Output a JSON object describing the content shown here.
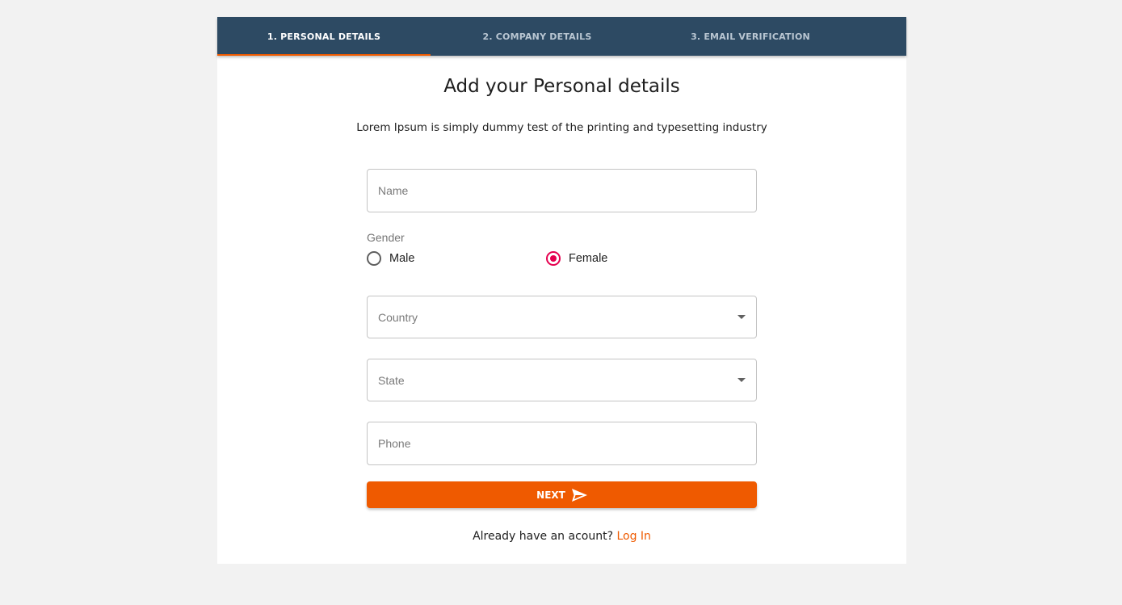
{
  "tabs": [
    {
      "label": "1. Personal Details",
      "active": true
    },
    {
      "label": "2. Company Details",
      "active": false
    },
    {
      "label": "3. Email Verification",
      "active": false
    }
  ],
  "form": {
    "title": "Add your Personal details",
    "subtitle": "Lorem Ipsum is simply dummy test of the printing and typesetting industry",
    "name_placeholder": "Name",
    "gender_label": "Gender",
    "gender_options": [
      {
        "label": "Male",
        "selected": false
      },
      {
        "label": "Female",
        "selected": true
      }
    ],
    "country_placeholder": "Country",
    "state_placeholder": "State",
    "phone_placeholder": "Phone",
    "next_label": "NEXT",
    "login_prompt": "Already have an acount?",
    "login_link": "Log In"
  },
  "colors": {
    "tab_bar": "#2d4a63",
    "accent": "#ef5a00",
    "radio_selected": "#e5004f"
  },
  "icons": {
    "next": "send-icon",
    "select": "caret-down-icon"
  }
}
